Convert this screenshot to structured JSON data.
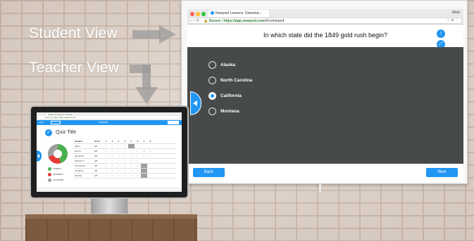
{
  "labels": {
    "student_view": "Student View",
    "teacher_view": "Teacher View"
  },
  "projector": {
    "tab_title": "Nearpod Lessons: Downloa...",
    "user_name": "Mark",
    "url_secure": "Secure",
    "url_host": "https://app.nearpod.com",
    "url_path": "/#/command",
    "question": "In which state did the 1849 gold rush begin?",
    "options": [
      {
        "label": "Alaska",
        "selected": false
      },
      {
        "label": "North Carolina",
        "selected": false
      },
      {
        "label": "California",
        "selected": true
      },
      {
        "label": "Montana",
        "selected": false
      }
    ],
    "back_label": "Back",
    "next_label": "Next"
  },
  "monitor": {
    "tab_title": "Nearpod Lessons: Downlo...",
    "url": "Secure | https://app.nearpod.com",
    "top_tag": "LIVE",
    "top_badge": "",
    "brand": "nearpod",
    "end_label": "",
    "quiz_title": "Quiz Title",
    "table_head": [
      "Student",
      "Score",
      "1",
      "2",
      "3",
      "4",
      "5",
      "6",
      "7",
      "8"
    ],
    "legend": [
      {
        "label": "CORRECT",
        "color": "#4caf50"
      },
      {
        "label": "INCORRECT",
        "color": "#e53935"
      },
      {
        "label": "NO ANSWER",
        "color": "#9e9e9e"
      }
    ],
    "rows": [
      {
        "name": "Albert",
        "score": "5/8",
        "cells": [
          "✓",
          "✓",
          "✓",
          "✓",
          "g",
          "",
          "",
          ""
        ]
      },
      {
        "name": "Emma",
        "score": "6/8",
        "cells": [
          "✓",
          "✓",
          "✓",
          "✓",
          "✓",
          "✓",
          "x",
          "x"
        ]
      },
      {
        "name": "Alexander",
        "score": "3/8",
        "cells": [
          "✓",
          "✓",
          "✓",
          "✓",
          "✓",
          "x",
          "✓",
          "✓"
        ]
      },
      {
        "name": "Malcolm T.",
        "score": "4/8",
        "cells": [
          "✓",
          "✓",
          "✓",
          "✓",
          "x",
          "✓",
          "",
          ""
        ]
      },
      {
        "name": "Christopher",
        "score": "5/8",
        "cells": [
          "✓",
          "✓",
          "✓",
          "✓",
          "✓",
          "x",
          "g",
          ""
        ]
      },
      {
        "name": "Jonathan",
        "score": "4/8",
        "cells": [
          "✓",
          "✓",
          "✓",
          "✓",
          "✓",
          "✓",
          "g",
          ""
        ]
      },
      {
        "name": "Michael",
        "score": "4/8",
        "cells": [
          "✓",
          "✓",
          "✓",
          "✓",
          "✓",
          "✓",
          "g",
          ""
        ]
      }
    ],
    "bottom_left": "",
    "bottom_mid": "",
    "bottom_right": ""
  },
  "colors": {
    "accent": "#2196f3",
    "panel": "#474a4a"
  }
}
